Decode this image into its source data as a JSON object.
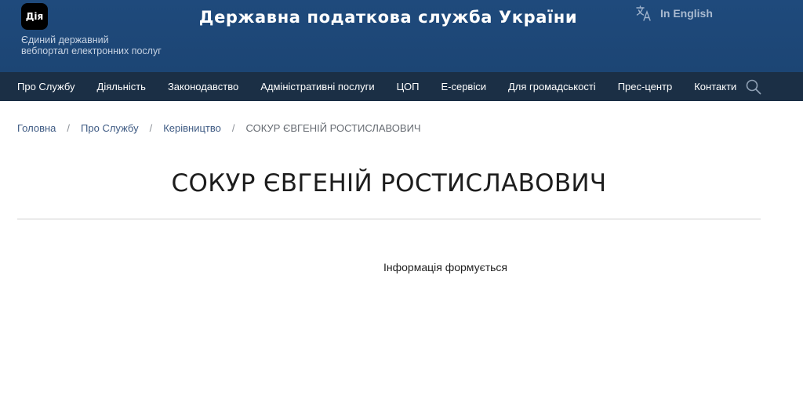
{
  "header": {
    "diia_logo": "Дія",
    "diia_caption_line1": "Єдиний державний",
    "diia_caption_line2": "вебпортал електронних послуг",
    "site_title": "Державна податкова служба України",
    "language_switch": "In English",
    "language_icon": "translate-icon",
    "background_color": "#1f4a7c"
  },
  "nav": {
    "background_color": "#1b2f45",
    "items": [
      "Про Службу",
      "Діяльність",
      "Законодавство",
      "Адміністративні послуги",
      "ЦОП",
      "Е-сервіси",
      "Для громадськості",
      "Прес-центр",
      "Контакти"
    ],
    "search_icon": "search-icon"
  },
  "breadcrumb": {
    "items": [
      "Головна",
      "Про Службу",
      "Керівництво"
    ],
    "separator": "/",
    "current": "СОКУР ЄВГЕНІЙ РОСТИСЛАВОВИЧ"
  },
  "main": {
    "title": "СОКУР ЄВГЕНІЙ РОСТИСЛАВОВИЧ",
    "info": "Інформація формується"
  }
}
